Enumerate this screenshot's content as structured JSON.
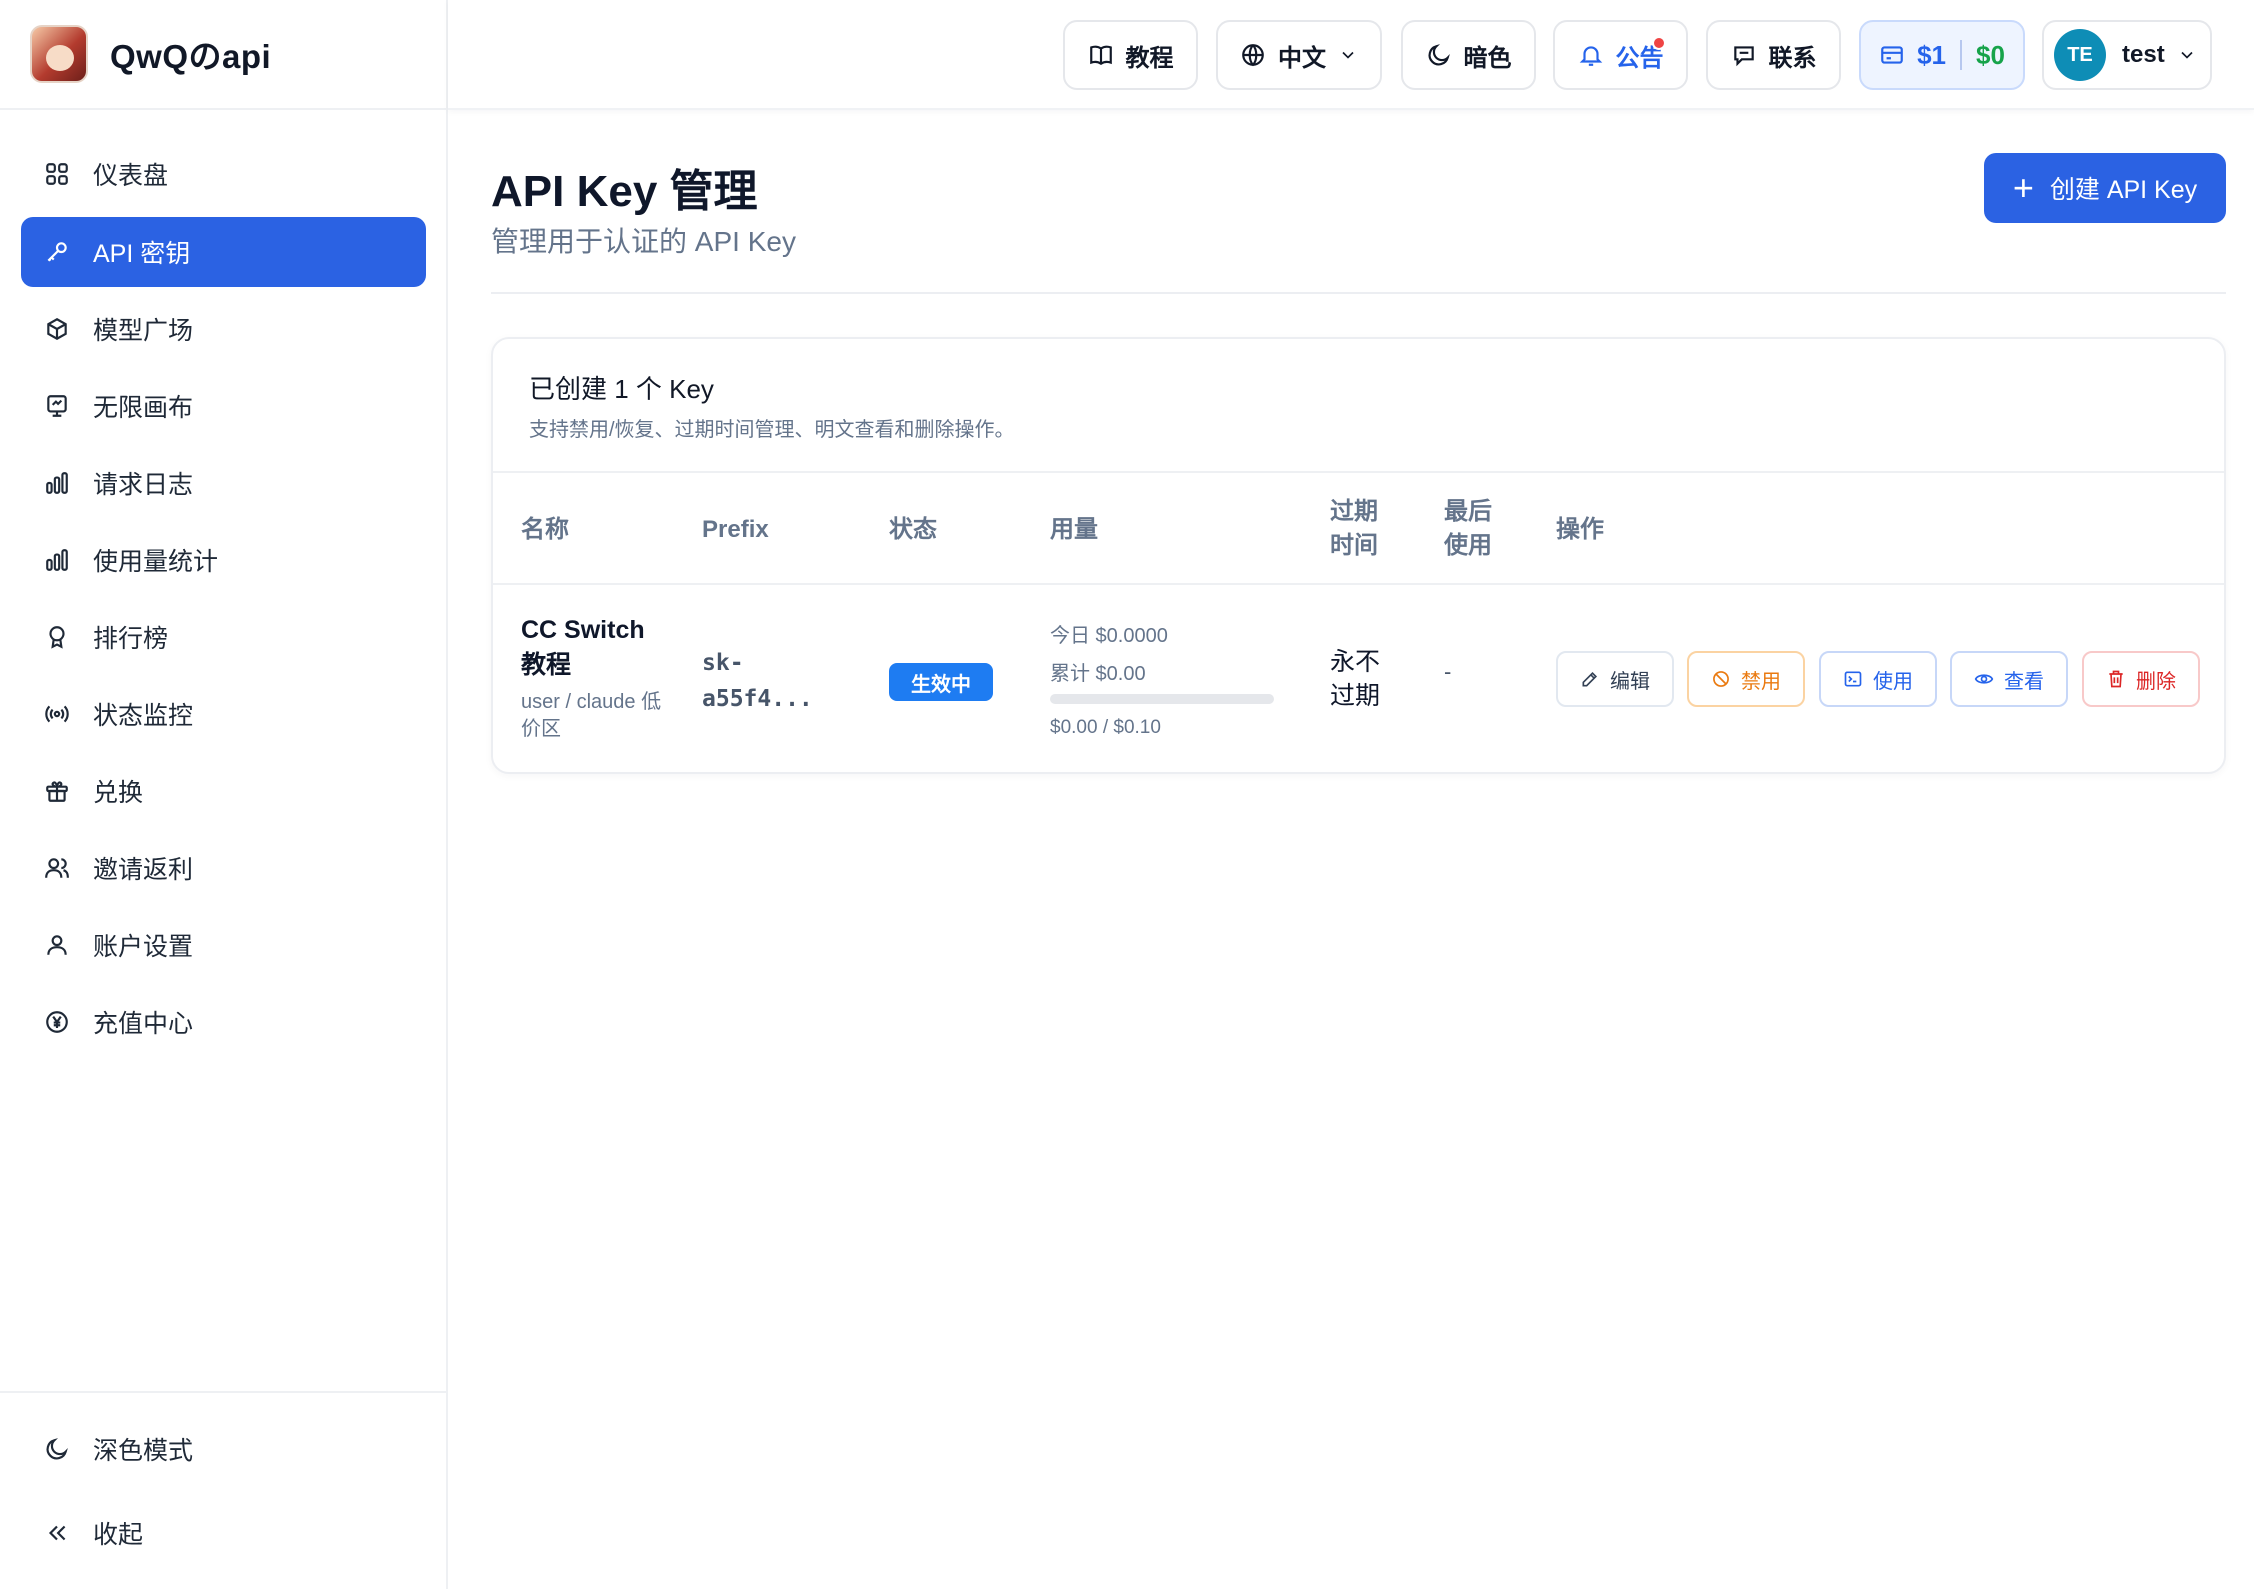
{
  "brand": {
    "name": "QwQのapi"
  },
  "sidebar": {
    "items": [
      {
        "label": "仪表盘",
        "icon": "grid-icon"
      },
      {
        "label": "API 密钥",
        "icon": "key-icon",
        "active": true
      },
      {
        "label": "模型广场",
        "icon": "cube-icon"
      },
      {
        "label": "无限画布",
        "icon": "canvas-icon"
      },
      {
        "label": "请求日志",
        "icon": "bar-chart-icon"
      },
      {
        "label": "使用量统计",
        "icon": "bar-chart-icon"
      },
      {
        "label": "排行榜",
        "icon": "trophy-icon"
      },
      {
        "label": "状态监控",
        "icon": "signal-icon"
      },
      {
        "label": "兑换",
        "icon": "gift-icon"
      },
      {
        "label": "邀请返利",
        "icon": "users-icon"
      },
      {
        "label": "账户设置",
        "icon": "user-icon"
      },
      {
        "label": "充值中心",
        "icon": "yen-icon"
      }
    ],
    "bottom": [
      {
        "label": "深色模式",
        "icon": "moon-icon"
      },
      {
        "label": "收起",
        "icon": "collapse-icon"
      }
    ]
  },
  "header": {
    "tutorial": "教程",
    "language": "中文",
    "theme": "暗色",
    "notice": "公告",
    "contact": "联系",
    "balance_primary": "$1",
    "balance_secondary": "$0",
    "avatar_initials": "TE",
    "username": "test"
  },
  "colors": {
    "accent": "#2b62e3",
    "danger": "#dc2626",
    "warning": "#ea7a10",
    "success": "#16a34a"
  },
  "page": {
    "title": "API Key 管理",
    "subtitle": "管理用于认证的 API Key",
    "create_button": "创建 API Key"
  },
  "card": {
    "title": "已创建 1 个 Key",
    "description": "支持禁用/恢复、过期时间管理、明文查看和删除操作。"
  },
  "table": {
    "headers": {
      "name": "名称",
      "prefix": "Prefix",
      "status": "状态",
      "usage": "用量",
      "expire_line1": "过期",
      "expire_line2": "时间",
      "last_line1": "最后",
      "last_line2": "使用",
      "actions": "操作"
    },
    "rows": [
      {
        "name": "CC Switch 教程",
        "meta": "user / claude 低价区",
        "prefix": "sk-a55f4...",
        "status": "生效中",
        "usage_today": "今日 $0.0000",
        "usage_total": "累计 $0.00",
        "usage_progress": 0,
        "usage_quota": "$0.00 / $0.10",
        "expire": "永不过期",
        "last_used": "-",
        "actions": {
          "edit": "编辑",
          "disable": "禁用",
          "use": "使用",
          "view": "查看",
          "delete": "删除"
        }
      }
    ]
  }
}
